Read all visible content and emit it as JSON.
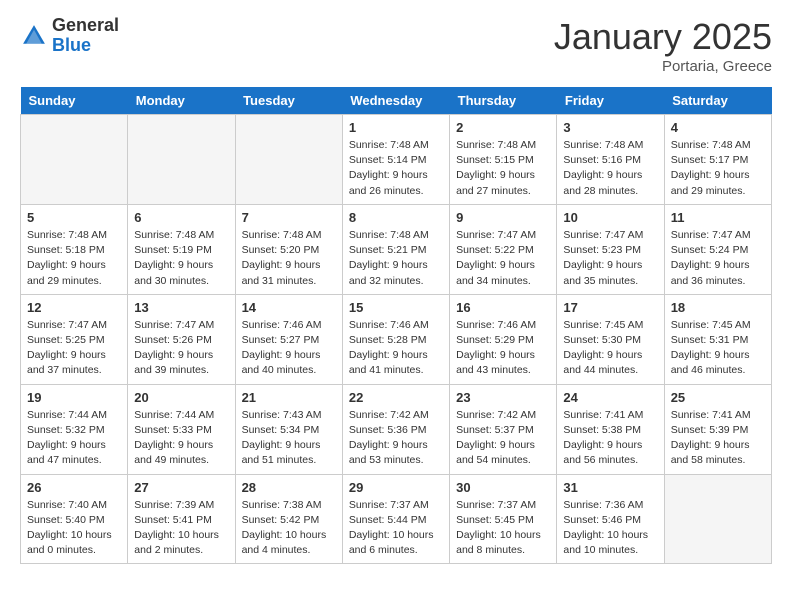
{
  "header": {
    "logo_general": "General",
    "logo_blue": "Blue",
    "title": "January 2025",
    "subtitle": "Portaria, Greece"
  },
  "days_of_week": [
    "Sunday",
    "Monday",
    "Tuesday",
    "Wednesday",
    "Thursday",
    "Friday",
    "Saturday"
  ],
  "weeks": [
    [
      {
        "date": "",
        "info": ""
      },
      {
        "date": "",
        "info": ""
      },
      {
        "date": "",
        "info": ""
      },
      {
        "date": "1",
        "info": "Sunrise: 7:48 AM\nSunset: 5:14 PM\nDaylight: 9 hours and 26 minutes."
      },
      {
        "date": "2",
        "info": "Sunrise: 7:48 AM\nSunset: 5:15 PM\nDaylight: 9 hours and 27 minutes."
      },
      {
        "date": "3",
        "info": "Sunrise: 7:48 AM\nSunset: 5:16 PM\nDaylight: 9 hours and 28 minutes."
      },
      {
        "date": "4",
        "info": "Sunrise: 7:48 AM\nSunset: 5:17 PM\nDaylight: 9 hours and 29 minutes."
      }
    ],
    [
      {
        "date": "5",
        "info": "Sunrise: 7:48 AM\nSunset: 5:18 PM\nDaylight: 9 hours and 29 minutes."
      },
      {
        "date": "6",
        "info": "Sunrise: 7:48 AM\nSunset: 5:19 PM\nDaylight: 9 hours and 30 minutes."
      },
      {
        "date": "7",
        "info": "Sunrise: 7:48 AM\nSunset: 5:20 PM\nDaylight: 9 hours and 31 minutes."
      },
      {
        "date": "8",
        "info": "Sunrise: 7:48 AM\nSunset: 5:21 PM\nDaylight: 9 hours and 32 minutes."
      },
      {
        "date": "9",
        "info": "Sunrise: 7:47 AM\nSunset: 5:22 PM\nDaylight: 9 hours and 34 minutes."
      },
      {
        "date": "10",
        "info": "Sunrise: 7:47 AM\nSunset: 5:23 PM\nDaylight: 9 hours and 35 minutes."
      },
      {
        "date": "11",
        "info": "Sunrise: 7:47 AM\nSunset: 5:24 PM\nDaylight: 9 hours and 36 minutes."
      }
    ],
    [
      {
        "date": "12",
        "info": "Sunrise: 7:47 AM\nSunset: 5:25 PM\nDaylight: 9 hours and 37 minutes."
      },
      {
        "date": "13",
        "info": "Sunrise: 7:47 AM\nSunset: 5:26 PM\nDaylight: 9 hours and 39 minutes."
      },
      {
        "date": "14",
        "info": "Sunrise: 7:46 AM\nSunset: 5:27 PM\nDaylight: 9 hours and 40 minutes."
      },
      {
        "date": "15",
        "info": "Sunrise: 7:46 AM\nSunset: 5:28 PM\nDaylight: 9 hours and 41 minutes."
      },
      {
        "date": "16",
        "info": "Sunrise: 7:46 AM\nSunset: 5:29 PM\nDaylight: 9 hours and 43 minutes."
      },
      {
        "date": "17",
        "info": "Sunrise: 7:45 AM\nSunset: 5:30 PM\nDaylight: 9 hours and 44 minutes."
      },
      {
        "date": "18",
        "info": "Sunrise: 7:45 AM\nSunset: 5:31 PM\nDaylight: 9 hours and 46 minutes."
      }
    ],
    [
      {
        "date": "19",
        "info": "Sunrise: 7:44 AM\nSunset: 5:32 PM\nDaylight: 9 hours and 47 minutes."
      },
      {
        "date": "20",
        "info": "Sunrise: 7:44 AM\nSunset: 5:33 PM\nDaylight: 9 hours and 49 minutes."
      },
      {
        "date": "21",
        "info": "Sunrise: 7:43 AM\nSunset: 5:34 PM\nDaylight: 9 hours and 51 minutes."
      },
      {
        "date": "22",
        "info": "Sunrise: 7:42 AM\nSunset: 5:36 PM\nDaylight: 9 hours and 53 minutes."
      },
      {
        "date": "23",
        "info": "Sunrise: 7:42 AM\nSunset: 5:37 PM\nDaylight: 9 hours and 54 minutes."
      },
      {
        "date": "24",
        "info": "Sunrise: 7:41 AM\nSunset: 5:38 PM\nDaylight: 9 hours and 56 minutes."
      },
      {
        "date": "25",
        "info": "Sunrise: 7:41 AM\nSunset: 5:39 PM\nDaylight: 9 hours and 58 minutes."
      }
    ],
    [
      {
        "date": "26",
        "info": "Sunrise: 7:40 AM\nSunset: 5:40 PM\nDaylight: 10 hours and 0 minutes."
      },
      {
        "date": "27",
        "info": "Sunrise: 7:39 AM\nSunset: 5:41 PM\nDaylight: 10 hours and 2 minutes."
      },
      {
        "date": "28",
        "info": "Sunrise: 7:38 AM\nSunset: 5:42 PM\nDaylight: 10 hours and 4 minutes."
      },
      {
        "date": "29",
        "info": "Sunrise: 7:37 AM\nSunset: 5:44 PM\nDaylight: 10 hours and 6 minutes."
      },
      {
        "date": "30",
        "info": "Sunrise: 7:37 AM\nSunset: 5:45 PM\nDaylight: 10 hours and 8 minutes."
      },
      {
        "date": "31",
        "info": "Sunrise: 7:36 AM\nSunset: 5:46 PM\nDaylight: 10 hours and 10 minutes."
      },
      {
        "date": "",
        "info": ""
      }
    ]
  ]
}
